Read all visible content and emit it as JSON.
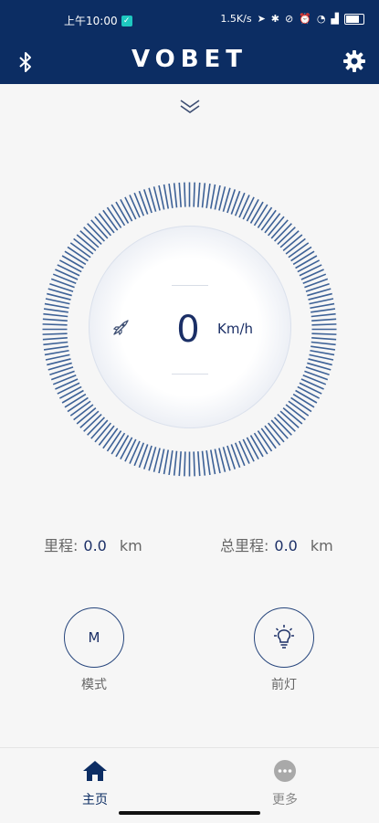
{
  "status_bar": {
    "time": "上午10:00",
    "network_speed": "1.5K/s",
    "battery_level": "100"
  },
  "header": {
    "title": "VOBET",
    "left_icon": "bluetooth-icon",
    "right_icon": "gear-icon",
    "background": "#0c2d63"
  },
  "speedometer": {
    "value": "0",
    "unit": "Km/h",
    "icon": "rocket-icon",
    "accent": "#3d6196"
  },
  "stats": {
    "trip_label": "里程:",
    "trip_value": "0.0",
    "trip_unit": "km",
    "total_label": "总里程:",
    "total_value": "0.0",
    "total_unit": "km"
  },
  "controls": {
    "mode_button_text": "M",
    "mode_label": "模式",
    "headlight_label": "前灯",
    "headlight_icon": "lightbulb-icon"
  },
  "bottom_nav": {
    "home_label": "主页",
    "home_icon": "home-icon",
    "more_label": "更多",
    "more_icon": "more-icon",
    "active": "home",
    "active_color": "#0c2d63",
    "inactive_color": "#888888"
  }
}
